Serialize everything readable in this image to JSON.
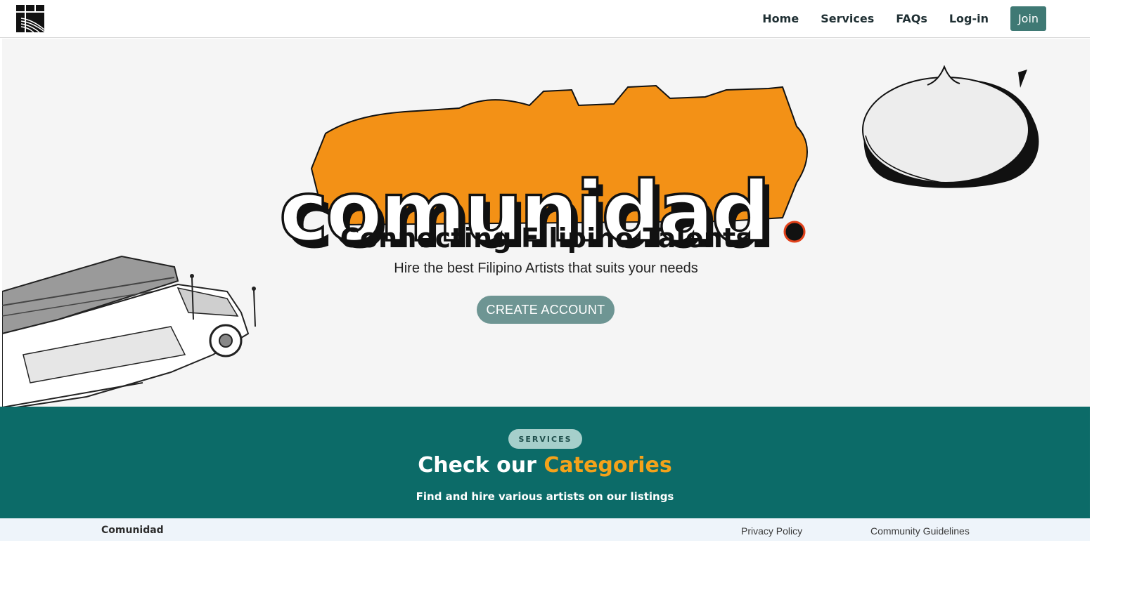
{
  "header": {
    "nav": [
      {
        "label": "Home"
      },
      {
        "label": "Services"
      },
      {
        "label": "FAQs"
      },
      {
        "label": "Log-in"
      }
    ],
    "join_label": "Join"
  },
  "hero": {
    "brand_word": "comunidad",
    "title": "Connecting Filipino Talents",
    "subtitle": "Hire the best Filipino Artists that suits your needs",
    "cta_label": "CREATE ACCOUNT"
  },
  "services": {
    "badge": "SERVICES",
    "title_prefix": "Check our ",
    "title_accent": "Categories",
    "subtitle": "Find and hire various artists on our listings"
  },
  "footer": {
    "brand": "Comunidad",
    "links": [
      {
        "label": "Privacy Policy"
      },
      {
        "label": "Community Guidelines"
      }
    ]
  },
  "colors": {
    "primary_teal": "#0c6b68",
    "button_teal": "#3f7974",
    "cta_sage": "#6e9593",
    "accent_orange": "#f4a21a",
    "hero_bg": "#f5f5f5"
  }
}
